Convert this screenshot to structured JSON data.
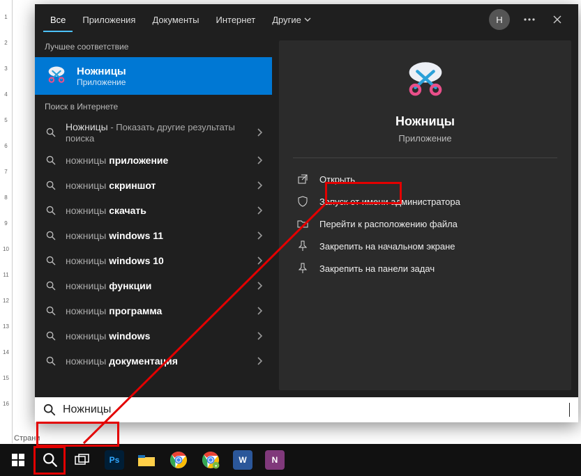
{
  "tabs": {
    "items": [
      {
        "label": "Все"
      },
      {
        "label": "Приложения"
      },
      {
        "label": "Документы"
      },
      {
        "label": "Интернет"
      },
      {
        "label": "Другие"
      }
    ],
    "avatar_initial": "Н"
  },
  "sections": {
    "best_match_header": "Лучшее соответствие",
    "web_header": "Поиск в Интернете"
  },
  "best_match": {
    "title": "Ножницы",
    "subtitle": "Приложение"
  },
  "web_results": [
    {
      "prefix": "",
      "query": "Ножницы",
      "suffix": " - Показать другие результаты поиска"
    },
    {
      "prefix": "ножницы ",
      "bold": "приложение"
    },
    {
      "prefix": "ножницы ",
      "bold": "скриншот"
    },
    {
      "prefix": "ножницы ",
      "bold": "скачать"
    },
    {
      "prefix": "ножницы ",
      "bold": "windows 11"
    },
    {
      "prefix": "ножницы ",
      "bold": "windows 10"
    },
    {
      "prefix": "ножницы ",
      "bold": "функции"
    },
    {
      "prefix": "ножницы ",
      "bold": "программа"
    },
    {
      "prefix": "ножницы ",
      "bold": "windows"
    },
    {
      "prefix": "ножницы ",
      "bold": "документация"
    }
  ],
  "preview": {
    "name": "Ножницы",
    "subtitle": "Приложение",
    "actions": [
      {
        "icon": "open",
        "label": "Открыть"
      },
      {
        "icon": "admin",
        "label": "Запуск от имени администратора"
      },
      {
        "icon": "folder",
        "label": "Перейти к расположению файла"
      },
      {
        "icon": "pin-start",
        "label": "Закрепить на начальном экране"
      },
      {
        "icon": "pin-task",
        "label": "Закрепить на панели задач"
      }
    ]
  },
  "search": {
    "value": "Ножницы"
  },
  "taskbar": {
    "apps": [
      {
        "name": "photoshop",
        "bg": "#001e36",
        "fg": "#31a8ff",
        "label": "Ps"
      },
      {
        "name": "explorer",
        "bg": "#ffcf48",
        "fg": "#1a6fb4",
        "label": ""
      },
      {
        "name": "chrome",
        "bg": "",
        "label": ""
      },
      {
        "name": "chrome-profile",
        "bg": "",
        "label": ""
      },
      {
        "name": "word",
        "bg": "#2b579a",
        "fg": "#fff",
        "label": "W"
      },
      {
        "name": "onenote",
        "bg": "#80397b",
        "fg": "#fff",
        "label": "N"
      }
    ]
  },
  "page_label": "Страни",
  "ruler_labels": [
    "1",
    "2",
    "3",
    "4",
    "5",
    "6",
    "7",
    "8",
    "9",
    "10",
    "11",
    "12",
    "13",
    "14",
    "15",
    "16"
  ]
}
